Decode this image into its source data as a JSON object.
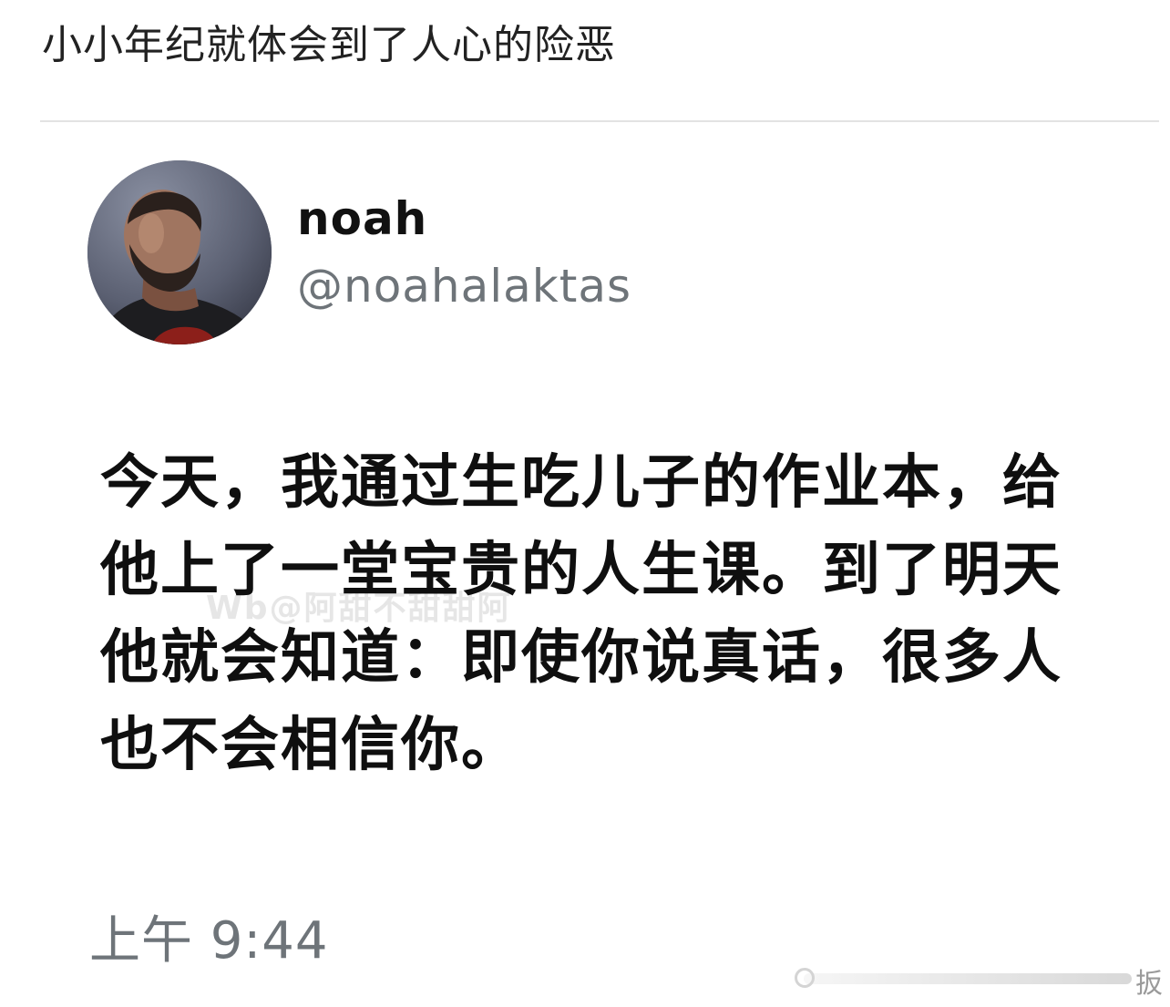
{
  "post": {
    "caption": "小小年纪就体会到了人心的险恶"
  },
  "tweet": {
    "display_name": "noah",
    "handle": "@noahalaktas",
    "text_lines": [
      "今天，我通过生吃儿子的作业本，给",
      "他上了一堂宝贵的人生课。到了明天",
      "他就会知道：即使你说真话，很多人",
      "也不会相信你。"
    ],
    "timestamp": "上午 9:44",
    "watermark": "Wb@阿甜不甜甜阿"
  },
  "corner_mark": {
    "glyph": "扳"
  },
  "colors": {
    "background": "#ffffff",
    "caption_text": "#222222",
    "tweet_text": "#0f0f0f",
    "secondary_text": "#6e7479",
    "divider": "#e3e3e3"
  },
  "icons": {
    "avatar": "profile-photo",
    "corner_mark": "weibo-watermark-icon"
  }
}
